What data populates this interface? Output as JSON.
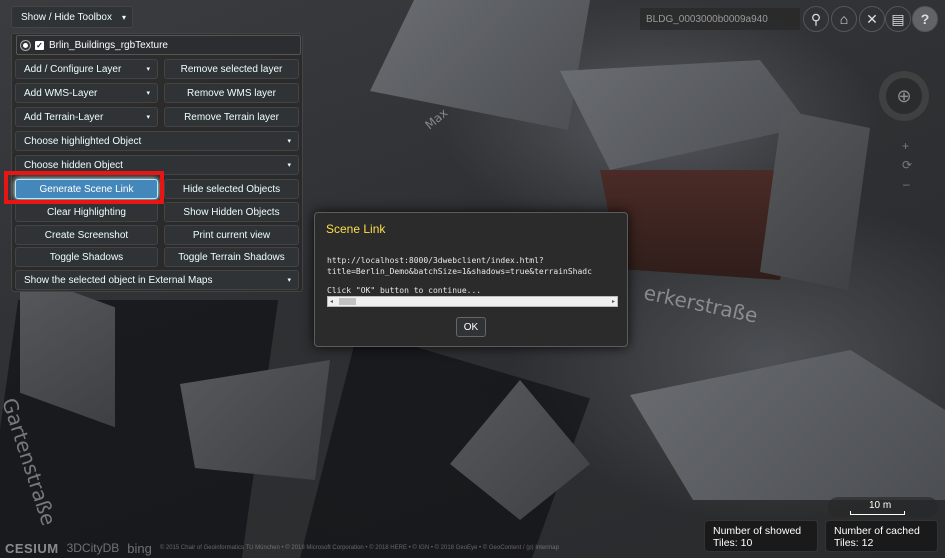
{
  "toolbox_toggle": {
    "label": "Show / Hide Toolbox",
    "caret": "▾"
  },
  "layer": {
    "name": "Brlin_Buildings_rgbTexture",
    "checked": true,
    "selected": true
  },
  "toolbox": {
    "add_configure_layer": "Add / Configure Layer",
    "remove_selected_layer": "Remove selected layer",
    "add_wms_layer": "Add WMS-Layer",
    "remove_wms_layer": "Remove WMS layer",
    "add_terrain_layer": "Add Terrain-Layer",
    "remove_terrain_layer": "Remove Terrain layer",
    "choose_highlighted_object": "Choose highlighted Object",
    "choose_hidden_object": "Choose hidden Object",
    "generate_scene_link": "Generate Scene Link",
    "hide_selected_objects": "Hide selected Objects",
    "clear_highlighting": "Clear Highlighting",
    "show_hidden_objects": "Show Hidden Objects",
    "create_screenshot": "Create Screenshot",
    "print_current_view": "Print current view",
    "toggle_shadows": "Toggle Shadows",
    "toggle_terrain_shadows": "Toggle Terrain Shadows",
    "show_in_external_maps": "Show the selected object in External Maps",
    "dropdown_caret": "▾"
  },
  "dialog": {
    "title": "Scene Link",
    "url_line1": "http://localhost:8000/3dwebclient/index.html?",
    "url_line2": "title=Berlin_Demo&batchSize=1&shadows=true&terrainShadc",
    "instruction": "Click \"OK\" button to continue...",
    "ok_label": "OK",
    "scroll_left": "◂",
    "scroll_right": "▸"
  },
  "top_right": {
    "object_id": "BLDG_0003000b0009a940",
    "search_glyph": "⚲",
    "home_glyph": "⌂",
    "tools_glyph": "✕",
    "layers_glyph": "▤",
    "help_glyph": "?"
  },
  "map": {
    "street_labels": [
      "Gartenstraße",
      "erkerstraße",
      "Max"
    ],
    "scale_label": "10 m",
    "tiles_showed_label": "Number of showed",
    "tiles_showed_value": "Tiles: 10",
    "tiles_cached_label": "Number of cached",
    "tiles_cached_value": "Tiles: 12"
  },
  "credits": {
    "cesium": "CESIUM",
    "citydb": "3DCityDB",
    "bing": "bing",
    "text": "© 2015 Chair of Geoinformatics TU München • © 2018 Microsoft Corporation • © 2018 HERE • © IGN • © 2018 GeoEye • © GeoContent / (p) Intermap"
  }
}
